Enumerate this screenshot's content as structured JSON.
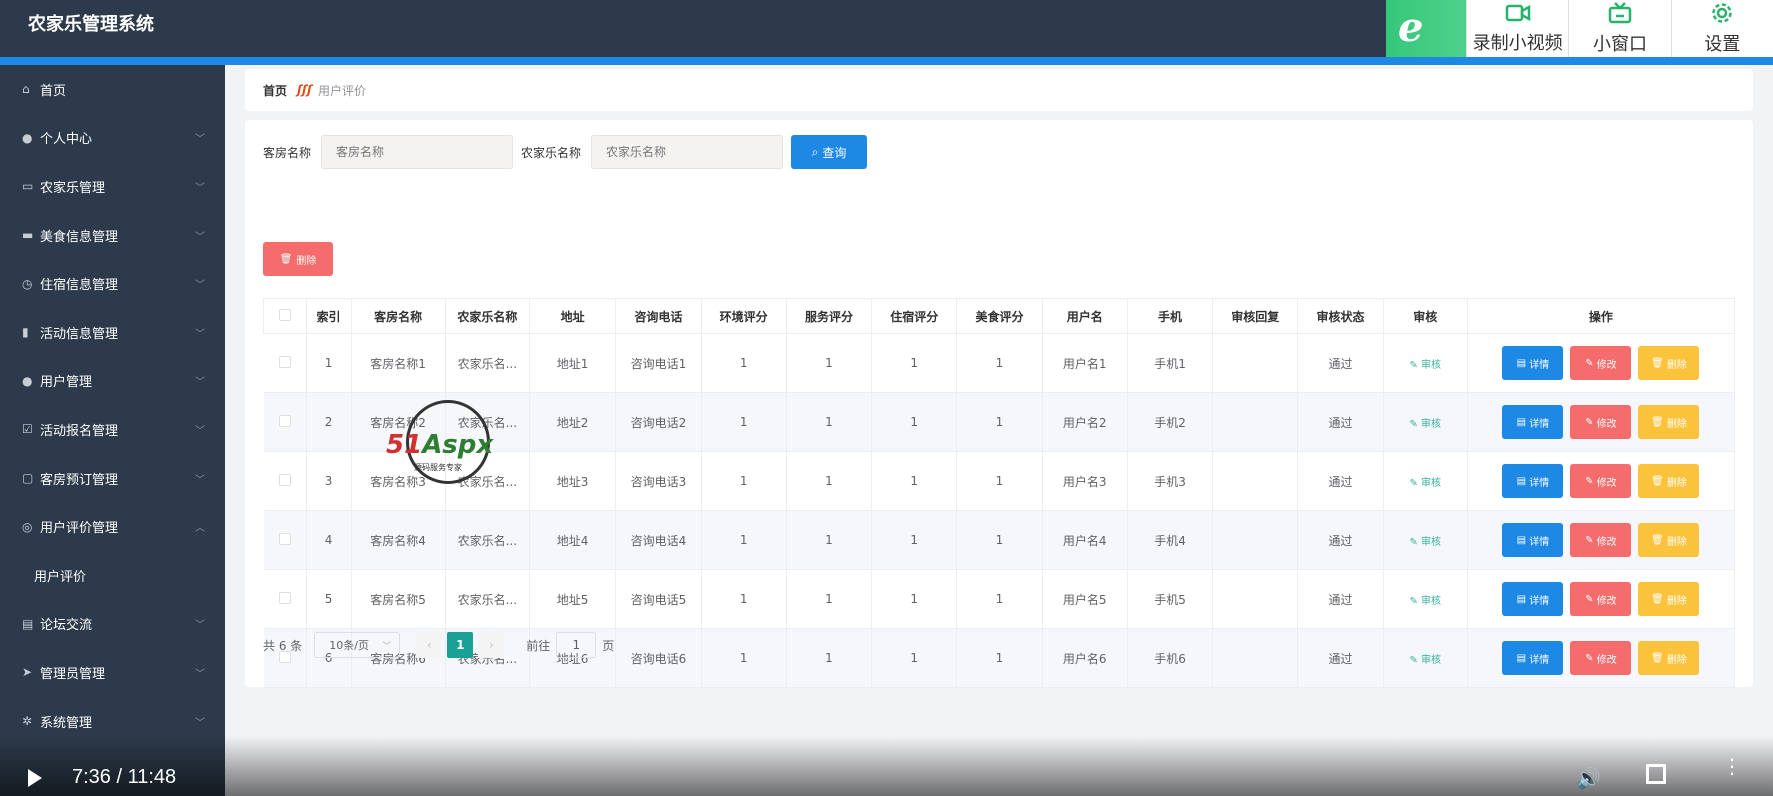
{
  "app": {
    "title": "农家乐管理系统"
  },
  "extension": {
    "buttons": [
      {
        "label": "录制小视频",
        "icon": "video-record-icon"
      },
      {
        "label": "小窗口",
        "icon": "tv-icon"
      },
      {
        "label": "设置",
        "icon": "gear-icon"
      }
    ]
  },
  "sidebar": {
    "items": [
      {
        "label": "首页",
        "icon": "home-icon",
        "expandable": false
      },
      {
        "label": "个人中心",
        "icon": "user-icon",
        "expandable": true
      },
      {
        "label": "农家乐管理",
        "icon": "card-icon",
        "expandable": true
      },
      {
        "label": "美食信息管理",
        "icon": "food-icon",
        "expandable": true
      },
      {
        "label": "住宿信息管理",
        "icon": "clock-icon",
        "expandable": true
      },
      {
        "label": "活动信息管理",
        "icon": "chart-icon",
        "expandable": true
      },
      {
        "label": "用户管理",
        "icon": "user-icon",
        "expandable": true
      },
      {
        "label": "活动报名管理",
        "icon": "check-icon",
        "expandable": true
      },
      {
        "label": "客房预订管理",
        "icon": "message-icon",
        "expandable": true
      },
      {
        "label": "用户评价管理",
        "icon": "globe-icon",
        "expandable": true,
        "open": true
      },
      {
        "label": "用户评价",
        "sub": true
      },
      {
        "label": "论坛交流",
        "icon": "briefcase-icon",
        "expandable": true
      },
      {
        "label": "管理员管理",
        "icon": "send-icon",
        "expandable": true
      },
      {
        "label": "系统管理",
        "icon": "settings-icon",
        "expandable": true
      }
    ]
  },
  "breadcrumb": {
    "home": "首页",
    "separator": "ʃʃʃ",
    "current": "用户评价"
  },
  "search": {
    "room_label": "客房名称",
    "room_placeholder": "客房名称",
    "farm_label": "农家乐名称",
    "farm_placeholder": "农家乐名称",
    "search_button": "查询"
  },
  "toolbar": {
    "delete_button": "删除"
  },
  "table": {
    "headers": [
      "索引",
      "客房名称",
      "农家乐名称",
      "地址",
      "咨询电话",
      "环境评分",
      "服务评分",
      "住宿评分",
      "美食评分",
      "用户名",
      "手机",
      "审核回复",
      "审核状态",
      "审核",
      "操作"
    ],
    "audit_label": "审核",
    "ops": {
      "detail": "详情",
      "edit": "修改",
      "delete": "删除"
    },
    "rows": [
      {
        "index": "1",
        "room": "客房名称1",
        "farm": "农家乐名...",
        "address": "地址1",
        "phone": "咨询电话1",
        "env": "1",
        "service": "1",
        "lodging": "1",
        "food": "1",
        "user": "用户名1",
        "mobile": "手机1",
        "reply": "",
        "status": "通过"
      },
      {
        "index": "2",
        "room": "客房名称2",
        "farm": "农家乐名...",
        "address": "地址2",
        "phone": "咨询电话2",
        "env": "1",
        "service": "1",
        "lodging": "1",
        "food": "1",
        "user": "用户名2",
        "mobile": "手机2",
        "reply": "",
        "status": "通过"
      },
      {
        "index": "3",
        "room": "客房名称3",
        "farm": "农家乐名...",
        "address": "地址3",
        "phone": "咨询电话3",
        "env": "1",
        "service": "1",
        "lodging": "1",
        "food": "1",
        "user": "用户名3",
        "mobile": "手机3",
        "reply": "",
        "status": "通过"
      },
      {
        "index": "4",
        "room": "客房名称4",
        "farm": "农家乐名...",
        "address": "地址4",
        "phone": "咨询电话4",
        "env": "1",
        "service": "1",
        "lodging": "1",
        "food": "1",
        "user": "用户名4",
        "mobile": "手机4",
        "reply": "",
        "status": "通过"
      },
      {
        "index": "5",
        "room": "客房名称5",
        "farm": "农家乐名...",
        "address": "地址5",
        "phone": "咨询电话5",
        "env": "1",
        "service": "1",
        "lodging": "1",
        "food": "1",
        "user": "用户名5",
        "mobile": "手机5",
        "reply": "",
        "status": "通过"
      },
      {
        "index": "6",
        "room": "客房名称6",
        "farm": "农家乐名...",
        "address": "地址6",
        "phone": "咨询电话6",
        "env": "1",
        "service": "1",
        "lodging": "1",
        "food": "1",
        "user": "用户名6",
        "mobile": "手机6",
        "reply": "",
        "status": "通过"
      }
    ]
  },
  "pagination": {
    "total": "共 6 条",
    "page_size": "10条/页",
    "current_page": "1",
    "goto_label": "前往",
    "goto_value": "1",
    "page_suffix": "页"
  },
  "watermark": {
    "brand_red": "51",
    "brand_green": "Aspx",
    "tagline": "源码服务专家"
  },
  "video": {
    "time": "7:36 / 11:48"
  },
  "colors": {
    "sidebar_bg": "#2d3a4b",
    "primary": "#1e88e5",
    "danger": "#f56c6c",
    "warning": "#fbc33b",
    "success": "#1aa094"
  }
}
